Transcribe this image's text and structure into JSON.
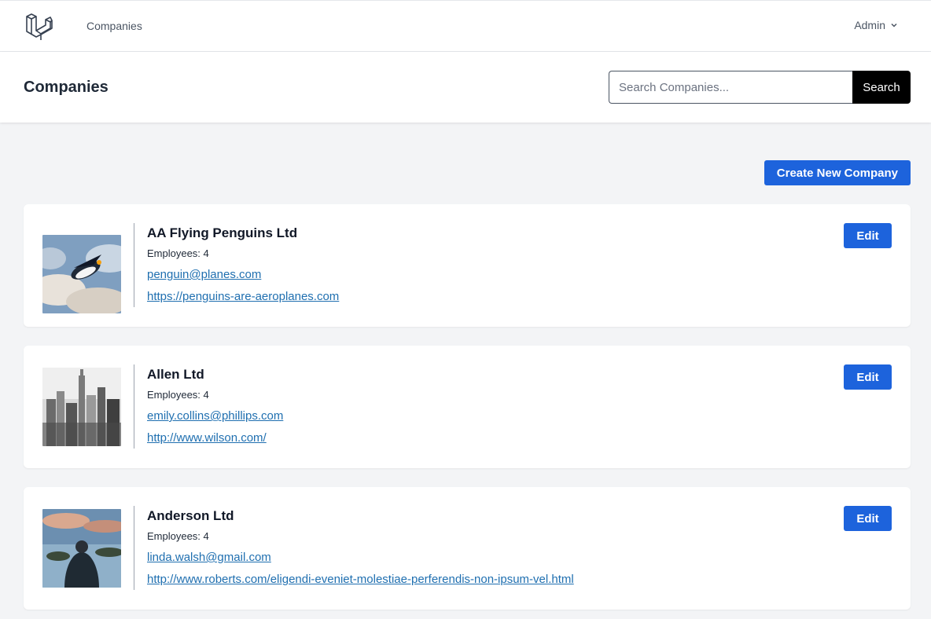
{
  "nav": {
    "link_companies": "Companies",
    "user_label": "Admin"
  },
  "header": {
    "title": "Companies",
    "search_placeholder": "Search Companies...",
    "search_button": "Search"
  },
  "actions": {
    "create_label": "Create New Company"
  },
  "companies": [
    {
      "name": "AA Flying Penguins Ltd",
      "employees": "Employees: 4",
      "email": "penguin@planes.com",
      "website": "https://penguins-are-aeroplanes.com",
      "edit_label": "Edit"
    },
    {
      "name": "Allen Ltd",
      "employees": "Employees: 4",
      "email": "emily.collins@phillips.com",
      "website": "http://www.wilson.com/",
      "edit_label": "Edit"
    },
    {
      "name": "Anderson Ltd",
      "employees": "Employees: 4",
      "email": "linda.walsh@gmail.com",
      "website": "http://www.roberts.com/eligendi-eveniet-molestiae-perferendis-non-ipsum-vel.html",
      "edit_label": "Edit"
    }
  ],
  "colors": {
    "primary": "#1d63dc",
    "link": "#1f6fb0",
    "background": "#f3f4f6"
  },
  "icons": {
    "logo": "laravel-logo-icon",
    "dropdown": "chevron-down-icon"
  }
}
